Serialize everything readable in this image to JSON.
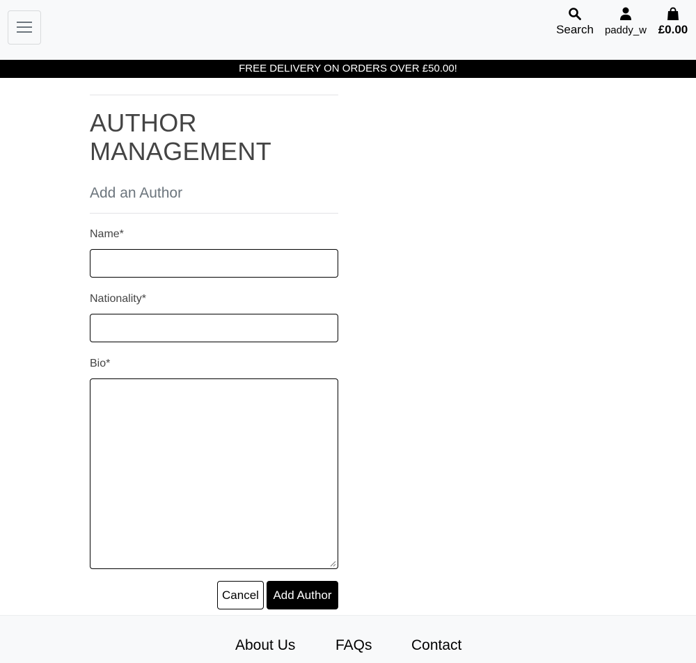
{
  "header": {
    "menu_icon": "hamburger-icon",
    "search": {
      "icon": "search-icon",
      "label": "Search"
    },
    "account": {
      "icon": "user-icon",
      "label": "paddy_w"
    },
    "bag": {
      "icon": "shopping-bag-icon",
      "total": "£0.00"
    }
  },
  "banner": {
    "text": "FREE DELIVERY ON ORDERS OVER £50.00!"
  },
  "page": {
    "title": "AUTHOR MANAGEMENT",
    "subtitle": "Add an Author"
  },
  "form": {
    "name_label": "Name*",
    "name_value": "",
    "nationality_label": "Nationality*",
    "nationality_value": "",
    "bio_label": "Bio*",
    "bio_value": "",
    "cancel_label": "Cancel",
    "submit_label": "Add Author"
  },
  "footer": {
    "links": [
      "About Us",
      "FAQs",
      "Contact"
    ]
  },
  "colors": {
    "banner_bg": "#000000",
    "header_bg": "#f8f9fa",
    "primary_button": "#000000"
  }
}
